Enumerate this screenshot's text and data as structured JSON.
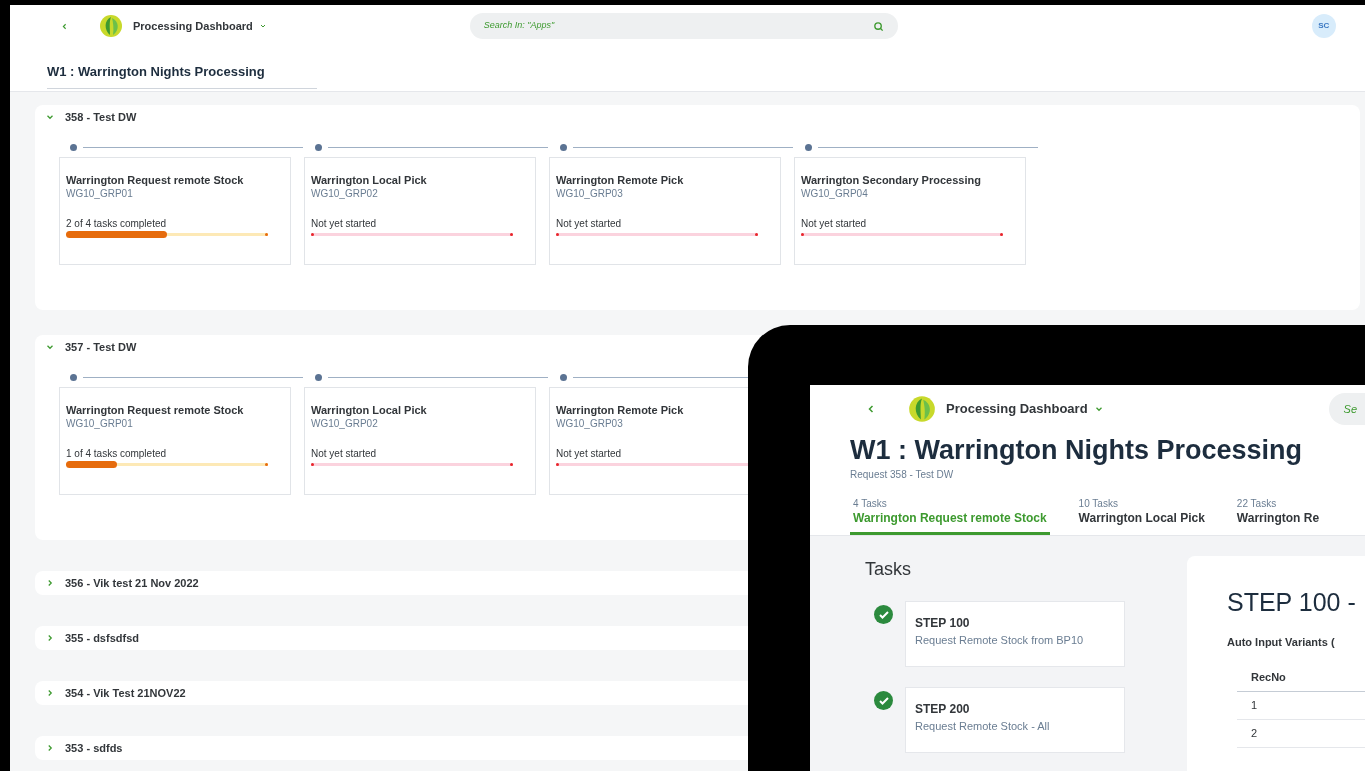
{
  "app": {
    "title": "Processing Dashboard",
    "search": {
      "placeholder": "Search In: \"Apps\""
    },
    "user_initials": "SC"
  },
  "page": {
    "title": "W1 : Warrington Nights Processing"
  },
  "requests": [
    {
      "label": "358 - Test DW",
      "expanded": true,
      "stages": [
        {
          "name": "Warrington Request remote Stock",
          "code": "WG10_GRP01",
          "status": "2 of 4 tasks completed",
          "level": 0.5
        },
        {
          "name": "Warrington Local Pick",
          "code": "WG10_GRP02",
          "status": "Not yet started",
          "level": 0
        },
        {
          "name": "Warrington Remote Pick",
          "code": "WG10_GRP03",
          "status": "Not yet started",
          "level": 0
        },
        {
          "name": "Warrington Secondary Processing",
          "code": "WG10_GRP04",
          "status": "Not yet started",
          "level": 0
        }
      ]
    },
    {
      "label": "357 - Test DW",
      "expanded": true,
      "stages": [
        {
          "name": "Warrington Request remote Stock",
          "code": "WG10_GRP01",
          "status": "1 of 4 tasks completed",
          "level": 0.25
        },
        {
          "name": "Warrington Local Pick",
          "code": "WG10_GRP02",
          "status": "Not yet started",
          "level": 0
        },
        {
          "name": "Warrington Remote Pick",
          "code": "WG10_GRP03",
          "status": "Not yet started",
          "level": 0
        }
      ]
    },
    {
      "label": "356 - Vik test 21 Nov 2022",
      "expanded": false
    },
    {
      "label": "355 - dsfsdfsd",
      "expanded": false
    },
    {
      "label": "354 - Vik Test 21NOV22",
      "expanded": false
    },
    {
      "label": "353 - sdfds",
      "expanded": false
    }
  ],
  "tablet": {
    "app_title": "Processing Dashboard",
    "search": {
      "placeholder": "Se"
    },
    "title": "W1 : Warrington Nights Processing",
    "subtitle": "Request 358 - Test DW",
    "tabs": [
      {
        "count": "4 Tasks",
        "label": "Warrington Request remote Stock",
        "selected": true
      },
      {
        "count": "10 Tasks",
        "label": "Warrington Local Pick",
        "selected": false
      },
      {
        "count": "22 Tasks",
        "label": "Warrington Re",
        "selected": false
      }
    ],
    "tasks_heading": "Tasks",
    "steps": [
      {
        "title": "STEP 100",
        "description": "Request Remote Stock from BP10",
        "done": true
      },
      {
        "title": "STEP 200",
        "description": "Request Remote Stock - All",
        "done": true
      }
    ],
    "detail": {
      "title": "STEP 100 -",
      "section": "Auto Input Variants (",
      "column": "RecNo",
      "rows": [
        "1",
        "2"
      ]
    }
  }
}
